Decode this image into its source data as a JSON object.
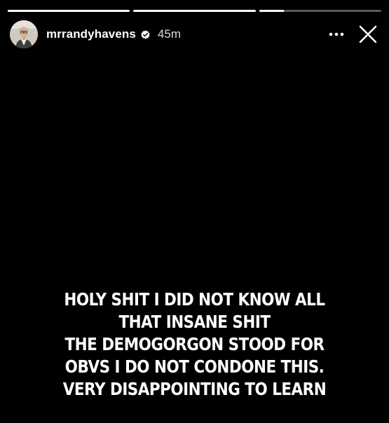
{
  "story": {
    "progress_segments": [
      {
        "filled_fraction": 1.0
      },
      {
        "filled_fraction": 1.0
      },
      {
        "filled_fraction": 0.2
      }
    ],
    "user": {
      "username": "mrrandyhavens",
      "verified": true,
      "time_ago": "45m",
      "avatar_icon": "profile-photo"
    },
    "actions": {
      "more_icon": "more-horizontal-icon",
      "close_icon": "close-icon"
    },
    "caption_lines": [
      "HOLY SHIT I DID NOT KNOW ALL",
      "THAT INSANE SHIT",
      "THE DEMOGORGON STOOD FOR",
      "OBVS I DO NOT CONDONE THIS.",
      "VERY DISAPPOINTING TO LEARN"
    ]
  },
  "colors": {
    "background": "#000000",
    "text": "#ffffff",
    "progress_track": "rgba(255,255,255,0.35)",
    "progress_fill": "#ffffff"
  }
}
